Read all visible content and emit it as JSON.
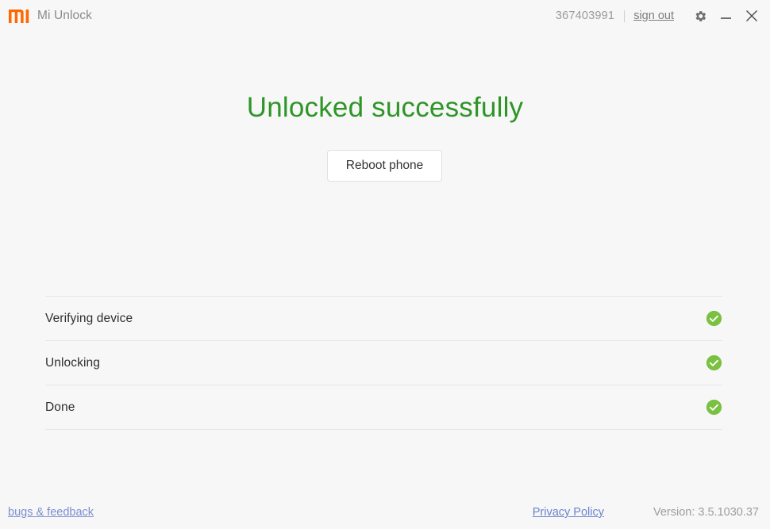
{
  "window": {
    "app_title": "Mi Unlock",
    "logo_icon": "mi-logo-icon",
    "logo_color": "#ff6700",
    "background_color": "#f7f7f7"
  },
  "titlebar": {
    "account_id": "367403991",
    "sign_out_label": "sign out",
    "settings_icon": "gear-icon",
    "minimize_icon": "minimize-icon",
    "close_icon": "close-icon"
  },
  "main": {
    "headline": "Unlocked successfully",
    "headline_color": "#2e9527",
    "reboot_button_label": "Reboot phone"
  },
  "steps": [
    {
      "label": "Verifying device",
      "status_icon": "check-circle-icon",
      "status": "complete"
    },
    {
      "label": "Unlocking",
      "status_icon": "check-circle-icon",
      "status": "complete"
    },
    {
      "label": "Done",
      "status_icon": "check-circle-icon",
      "status": "complete"
    }
  ],
  "status_colors": {
    "complete": "#7ac142"
  },
  "footer": {
    "bugs_feedback_label": "bugs & feedback",
    "privacy_policy_label": "Privacy Policy",
    "version_label": "Version: 3.5.1030.37"
  }
}
